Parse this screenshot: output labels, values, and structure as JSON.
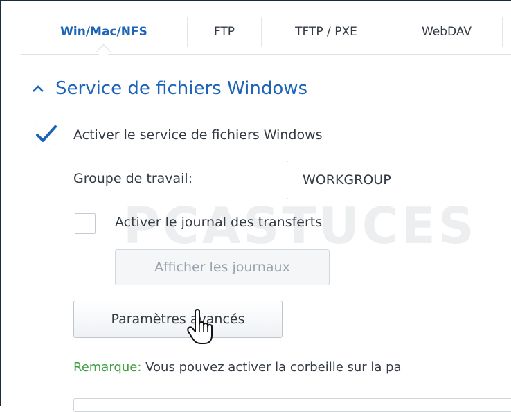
{
  "tabs": [
    {
      "label": "Win/Mac/NFS",
      "active": true
    },
    {
      "label": "FTP",
      "active": false
    },
    {
      "label": "TFTP / PXE",
      "active": false
    },
    {
      "label": "WebDAV",
      "active": false
    }
  ],
  "section": {
    "title": "Service de fichiers Windows",
    "collapse_icon": "chevron-up-icon"
  },
  "enable_windows": {
    "label": "Activer le service de fichiers Windows",
    "checked": true
  },
  "workgroup": {
    "label": "Groupe de travail:",
    "value": "WORKGROUP"
  },
  "transfer_log": {
    "label": "Activer le journal des transferts",
    "checked": false
  },
  "buttons": {
    "show_logs": "Afficher les journaux",
    "advanced": "Paramètres avancés"
  },
  "note": {
    "key": "Remarque:",
    "text": " Vous pouvez activer la corbeille sur la pa"
  },
  "watermark": {
    "text": "PCASTUCES"
  },
  "colors": {
    "accent": "#1d64b8",
    "note_green": "#3fa142",
    "text": "#333a44"
  }
}
